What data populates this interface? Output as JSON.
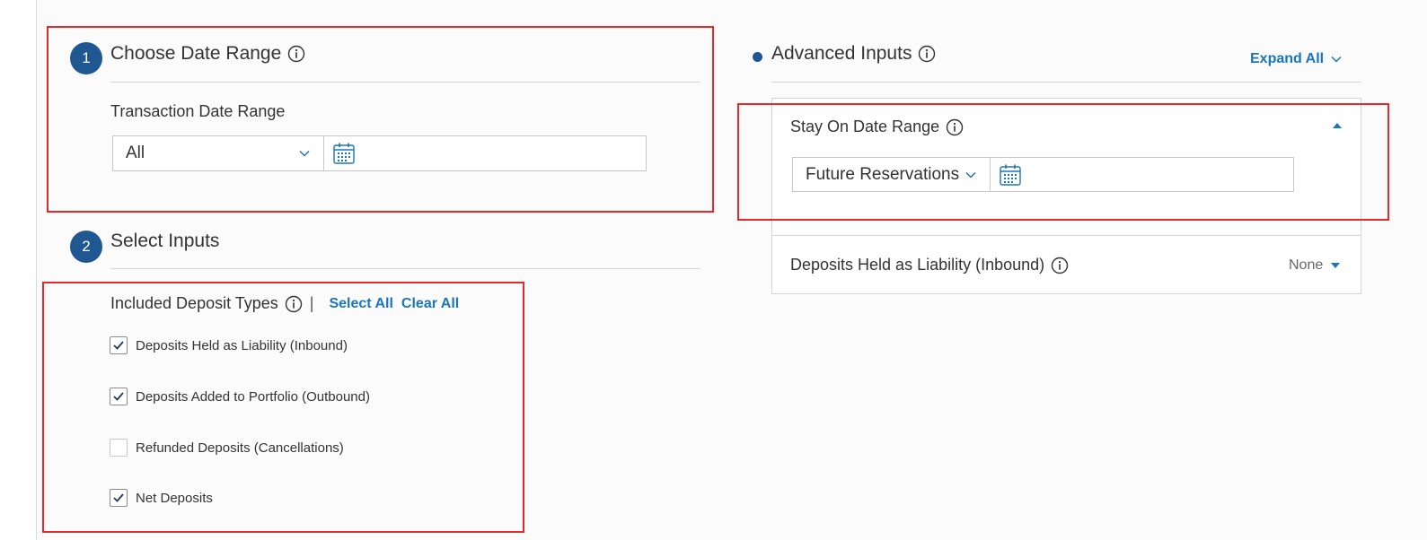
{
  "colors": {
    "accent": "#1f5793",
    "link": "#1b75bb",
    "highlight": "#e32b2b"
  },
  "step1": {
    "number": "1",
    "title": "Choose Date Range",
    "field_label": "Transaction Date Range",
    "range_value": "All",
    "icons": [
      "info-icon",
      "chevron-down-icon",
      "calendar-icon"
    ]
  },
  "step2": {
    "number": "2",
    "title": "Select Inputs",
    "group_label": "Included Deposit Types",
    "separator": "|",
    "select_all": "Select All",
    "clear_all": "Clear All",
    "options": [
      {
        "label": "Deposits Held as Liability (Inbound)",
        "checked": true
      },
      {
        "label": "Deposits Added to Portfolio (Outbound)",
        "checked": true
      },
      {
        "label": "Refunded Deposits (Cancellations)",
        "checked": false
      },
      {
        "label": "Net Deposits",
        "checked": true
      }
    ]
  },
  "advanced": {
    "title": "Advanced Inputs",
    "expand_all": "Expand All",
    "stay_section": {
      "title": "Stay On Date Range",
      "value": "Future Reservations",
      "expanded": true
    },
    "deposits_section": {
      "title": "Deposits Held as Liability (Inbound)",
      "value": "None",
      "expanded": false
    }
  }
}
